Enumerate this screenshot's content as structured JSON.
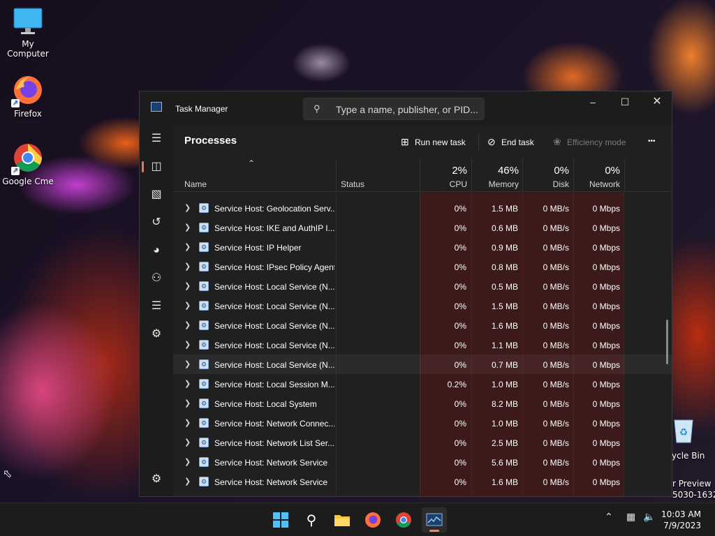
{
  "desktop": {
    "icons": [
      {
        "label": "My Computer"
      },
      {
        "label": "Firefox"
      },
      {
        "label": "Google Cme"
      }
    ],
    "recycle_bin_fragment": "ycle Bin",
    "watermark_line1": "r Preview",
    "watermark_line2": "5030-1632"
  },
  "window": {
    "title": "Task Manager",
    "search_placeholder": "Type a name, publisher, or PID...",
    "page_title": "Processes",
    "commands": {
      "run_new_task": "Run new task",
      "end_task": "End task",
      "efficiency_mode": "Efficiency mode",
      "more": "•••"
    }
  },
  "columns": {
    "name": "Name",
    "status": "Status",
    "cpu": {
      "label": "CPU",
      "pct": "2%"
    },
    "memory": {
      "label": "Memory",
      "pct": "46%"
    },
    "disk": {
      "label": "Disk",
      "pct": "0%"
    },
    "network": {
      "label": "Network",
      "pct": "0%"
    }
  },
  "rows": [
    {
      "name": "Service Host: Geolocation Serv...",
      "cpu": "0%",
      "memory": "1.5 MB",
      "disk": "0 MB/s",
      "network": "0 Mbps"
    },
    {
      "name": "Service Host: IKE and AuthIP I...",
      "cpu": "0%",
      "memory": "0.6 MB",
      "disk": "0 MB/s",
      "network": "0 Mbps"
    },
    {
      "name": "Service Host: IP Helper",
      "cpu": "0%",
      "memory": "0.9 MB",
      "disk": "0 MB/s",
      "network": "0 Mbps"
    },
    {
      "name": "Service Host: IPsec Policy Agent",
      "cpu": "0%",
      "memory": "0.8 MB",
      "disk": "0 MB/s",
      "network": "0 Mbps"
    },
    {
      "name": "Service Host: Local Service (N...",
      "cpu": "0%",
      "memory": "0.5 MB",
      "disk": "0 MB/s",
      "network": "0 Mbps"
    },
    {
      "name": "Service Host: Local Service (N...",
      "cpu": "0%",
      "memory": "1.5 MB",
      "disk": "0 MB/s",
      "network": "0 Mbps"
    },
    {
      "name": "Service Host: Local Service (N...",
      "cpu": "0%",
      "memory": "1.6 MB",
      "disk": "0 MB/s",
      "network": "0 Mbps"
    },
    {
      "name": "Service Host: Local Service (N...",
      "cpu": "0%",
      "memory": "1.1 MB",
      "disk": "0 MB/s",
      "network": "0 Mbps"
    },
    {
      "name": "Service Host: Local Service (N...",
      "cpu": "0%",
      "memory": "0.7 MB",
      "disk": "0 MB/s",
      "network": "0 Mbps"
    },
    {
      "name": "Service Host: Local Session M...",
      "cpu": "0.2%",
      "memory": "1.0 MB",
      "disk": "0 MB/s",
      "network": "0 Mbps"
    },
    {
      "name": "Service Host: Local System",
      "cpu": "0%",
      "memory": "8.2 MB",
      "disk": "0 MB/s",
      "network": "0 Mbps"
    },
    {
      "name": "Service Host: Network Connec...",
      "cpu": "0%",
      "memory": "1.0 MB",
      "disk": "0 MB/s",
      "network": "0 Mbps"
    },
    {
      "name": "Service Host: Network List Ser...",
      "cpu": "0%",
      "memory": "2.5 MB",
      "disk": "0 MB/s",
      "network": "0 Mbps"
    },
    {
      "name": "Service Host: Network Service",
      "cpu": "0%",
      "memory": "5.6 MB",
      "disk": "0 MB/s",
      "network": "0 Mbps"
    },
    {
      "name": "Service Host: Network Service",
      "cpu": "0%",
      "memory": "1.6 MB",
      "disk": "0 MB/s",
      "network": "0 Mbps"
    }
  ],
  "taskbar": {
    "time": "10:03 AM",
    "date": "7/9/2023"
  },
  "colors": {
    "accent": "#f26d5a",
    "heat": "#3c1a1a",
    "window_bg": "#202020"
  }
}
